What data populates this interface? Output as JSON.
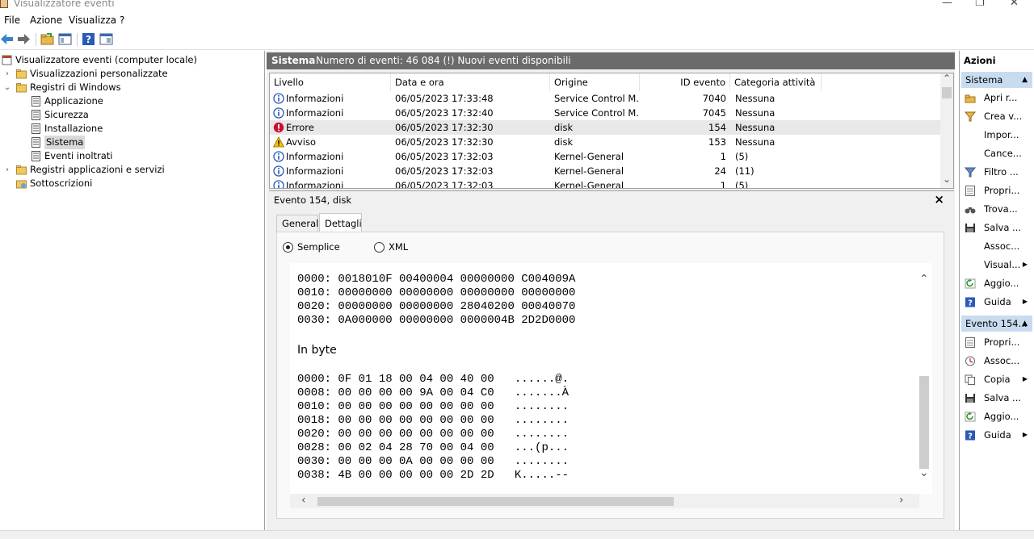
{
  "window": {
    "title": "Visualizzatore eventi"
  },
  "menu": [
    "File",
    "Azione",
    "Visualizza",
    "?"
  ],
  "tree": [
    {
      "label": "Visualizzatore eventi (computer locale)",
      "indent": 0,
      "chev": "",
      "icon": "event-viewer-icon"
    },
    {
      "label": "Visualizzazioni personalizzate",
      "indent": 1,
      "chev": "›",
      "icon": "folder-icon"
    },
    {
      "label": "Registri di Windows",
      "indent": 1,
      "chev": "⌄",
      "icon": "folder-icon"
    },
    {
      "label": "Applicazione",
      "indent": 2,
      "chev": "",
      "icon": "log-icon"
    },
    {
      "label": "Sicurezza",
      "indent": 2,
      "chev": "",
      "icon": "log-icon"
    },
    {
      "label": "Installazione",
      "indent": 2,
      "chev": "",
      "icon": "log-icon"
    },
    {
      "label": "Sistema",
      "indent": 2,
      "chev": "",
      "icon": "log-icon",
      "selected": true
    },
    {
      "label": "Eventi inoltrati",
      "indent": 2,
      "chev": "",
      "icon": "log-icon"
    },
    {
      "label": "Registri applicazioni e servizi",
      "indent": 1,
      "chev": "›",
      "icon": "folder-icon"
    },
    {
      "label": "Sottoscrizioni",
      "indent": 1,
      "chev": "",
      "icon": "subscription-icon"
    }
  ],
  "center": {
    "log_name": "Sistema",
    "event_count": "Numero di eventi: 46 084 (!) Nuovi eventi disponibili"
  },
  "columns": [
    "Livello",
    "Data e ora",
    "Origine",
    "ID evento",
    "Categoria attività"
  ],
  "events": [
    {
      "level": "Informazioni",
      "icon": "info",
      "datetime": "06/05/2023 17:33:48",
      "source": "Service Control M...",
      "id": "7040",
      "category": "Nessuna"
    },
    {
      "level": "Informazioni",
      "icon": "info",
      "datetime": "06/05/2023 17:32:40",
      "source": "Service Control M...",
      "id": "7045",
      "category": "Nessuna"
    },
    {
      "level": "Errore",
      "icon": "error",
      "datetime": "06/05/2023 17:32:30",
      "source": "disk",
      "id": "154",
      "category": "Nessuna",
      "selected": true
    },
    {
      "level": "Avviso",
      "icon": "warning",
      "datetime": "06/05/2023 17:32:30",
      "source": "disk",
      "id": "153",
      "category": "Nessuna"
    },
    {
      "level": "Informazioni",
      "icon": "info",
      "datetime": "06/05/2023 17:32:03",
      "source": "Kernel-General",
      "id": "1",
      "category": "(5)"
    },
    {
      "level": "Informazioni",
      "icon": "info",
      "datetime": "06/05/2023 17:32:03",
      "source": "Kernel-General",
      "id": "24",
      "category": "(11)"
    },
    {
      "level": "Informazioni",
      "icon": "info",
      "datetime": "06/05/2023 17:32:03",
      "source": "Kernel-General",
      "id": "1",
      "category": "(5)"
    }
  ],
  "detail": {
    "title": "Evento 154, disk",
    "tabs": [
      "Generale",
      "Dettagli"
    ],
    "active_tab": 1,
    "radio_simple": "Semplice",
    "radio_xml": "XML",
    "hex_lines": [
      "0000: 0018010F 00400004 00000000 C004009A",
      "0010: 00000000 00000000 00000000 00000000",
      "0020: 00000000 00000000 28040200 00040070",
      "0030: 0A000000 00000000 0000004B 2D2D0000"
    ],
    "in_byte_label": "In byte",
    "byte_lines": [
      "0000: 0F 01 18 00 04 00 40 00   ......@.",
      "0008: 00 00 00 00 9A 00 04 C0   .......À",
      "0010: 00 00 00 00 00 00 00 00   ........",
      "0018: 00 00 00 00 00 00 00 00   ........",
      "0020: 00 00 00 00 00 00 00 00   ........",
      "0028: 00 02 04 28 70 00 04 00   ...(p...",
      "0030: 00 00 00 0A 00 00 00 00   ........",
      "0038: 4B 00 00 00 00 00 2D 2D   K.....--"
    ]
  },
  "actions": {
    "title": "Azioni",
    "section1": "Sistema",
    "items1": [
      {
        "label": "Apri r...",
        "icon": "open-folder-icon",
        "sub": false
      },
      {
        "label": "Crea v...",
        "icon": "filter-create-icon",
        "sub": false
      },
      {
        "label": "Impor...",
        "icon": "",
        "sub": false
      },
      {
        "label": "Cance...",
        "icon": "",
        "sub": false
      },
      {
        "label": "Filtro ...",
        "icon": "filter-icon",
        "sub": false
      },
      {
        "label": "Propri...",
        "icon": "properties-icon",
        "sub": false
      },
      {
        "label": "Trova...",
        "icon": "binoculars-icon",
        "sub": false
      },
      {
        "label": "Salva ...",
        "icon": "save-icon",
        "sub": false
      },
      {
        "label": "Assoc...",
        "icon": "",
        "sub": false
      },
      {
        "label": "Visual...",
        "icon": "",
        "sub": true
      },
      {
        "label": "Aggio...",
        "icon": "refresh-icon",
        "sub": false
      },
      {
        "label": "Guida",
        "icon": "help-icon",
        "sub": true
      }
    ],
    "section2": "Evento 154...",
    "items2": [
      {
        "label": "Propri...",
        "icon": "properties-icon",
        "sub": false
      },
      {
        "label": "Assoc...",
        "icon": "task-icon",
        "sub": false
      },
      {
        "label": "Copia",
        "icon": "copy-icon",
        "sub": true
      },
      {
        "label": "Salva ...",
        "icon": "save-icon",
        "sub": false
      },
      {
        "label": "Aggio...",
        "icon": "refresh-icon",
        "sub": false
      },
      {
        "label": "Guida",
        "icon": "help-icon",
        "sub": true
      }
    ]
  }
}
